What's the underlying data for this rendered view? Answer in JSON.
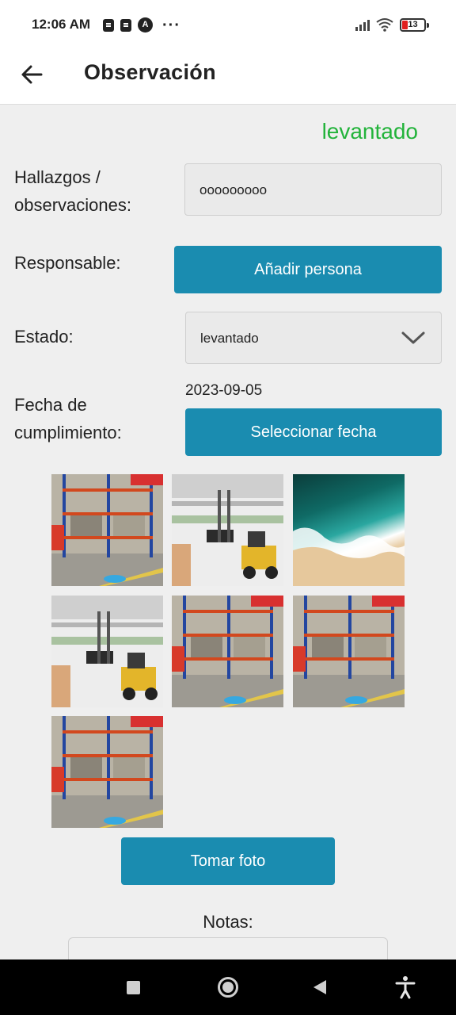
{
  "status_bar": {
    "time": "12:06 AM",
    "battery": "13"
  },
  "app_bar": {
    "title": "Observación",
    "back_icon": "arrow-left-icon"
  },
  "form": {
    "status_text": "levantado",
    "status_color": "#22b33a",
    "findings_label_line1": "Hallazgos /",
    "findings_label_line2": "observaciones:",
    "findings_value": "ooooooooo",
    "responsible_label": "Responsable:",
    "add_person_button": "Añadir persona",
    "state_label": "Estado:",
    "state_selected": "levantado",
    "due_date_label_line1": "Fecha de",
    "due_date_label_line2": "cumplimiento:",
    "due_date_value": "2023-09-05",
    "select_date_button": "Seleccionar fecha",
    "take_photo_button": "Tomar foto",
    "notes_label": "Notas:",
    "accent_color": "#1a8cb0"
  },
  "photos": [
    {
      "kind": "warehouse-rack"
    },
    {
      "kind": "forklift"
    },
    {
      "kind": "beach"
    },
    {
      "kind": "forklift"
    },
    {
      "kind": "warehouse-rack"
    },
    {
      "kind": "warehouse-rack"
    },
    {
      "kind": "warehouse-rack"
    }
  ],
  "nav_bar": {
    "icons": [
      "recent-apps-icon",
      "home-icon",
      "back-icon",
      "accessibility-icon"
    ]
  }
}
